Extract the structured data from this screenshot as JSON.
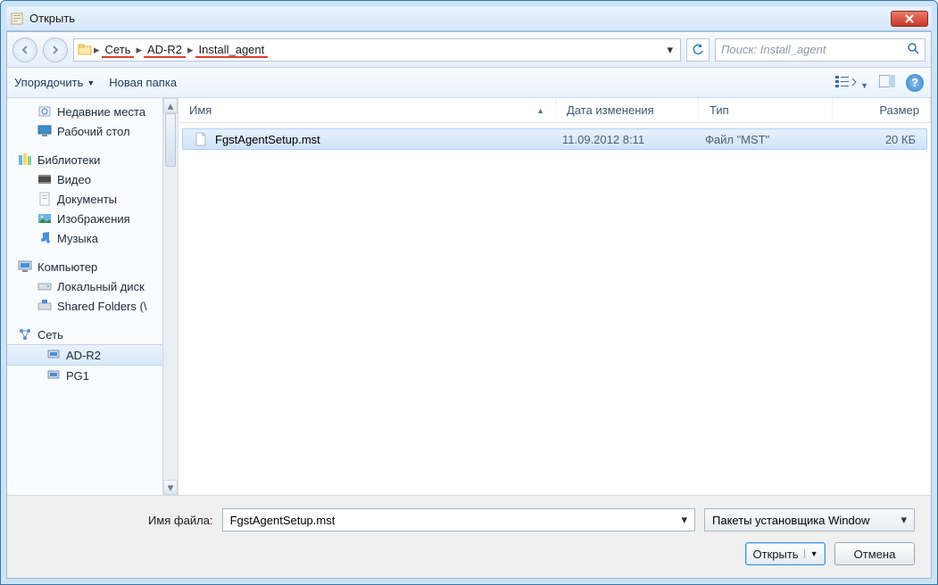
{
  "window": {
    "title": "Открыть"
  },
  "nav": {
    "crumbs": [
      "Сеть",
      "AD-R2",
      "Install_agent"
    ],
    "search_placeholder": "Поиск: Install_agent"
  },
  "toolbar": {
    "organize": "Упорядочить",
    "new_folder": "Новая папка"
  },
  "sidebar": {
    "recent": "Недавние места",
    "desktop": "Рабочий стол",
    "libraries": "Библиотеки",
    "video": "Видео",
    "documents": "Документы",
    "pictures": "Изображения",
    "music": "Музыка",
    "computer": "Компьютер",
    "localdisk": "Локальный диск",
    "shared": "Shared Folders (\\",
    "network": "Сеть",
    "adr2": "AD-R2",
    "pg1": "PG1",
    "extra": "…"
  },
  "columns": {
    "name": "Имя",
    "date": "Дата изменения",
    "type": "Тип",
    "size": "Размер"
  },
  "files": [
    {
      "name": "FgstAgentSetup.mst",
      "date": "11.09.2012 8:11",
      "type": "Файл \"MST\"",
      "size": "20 КБ"
    }
  ],
  "bottom": {
    "filename_label": "Имя файла:",
    "filename_value": "FgstAgentSetup.mst",
    "filter": "Пакеты установщика Window",
    "open": "Открыть",
    "cancel": "Отмена"
  }
}
